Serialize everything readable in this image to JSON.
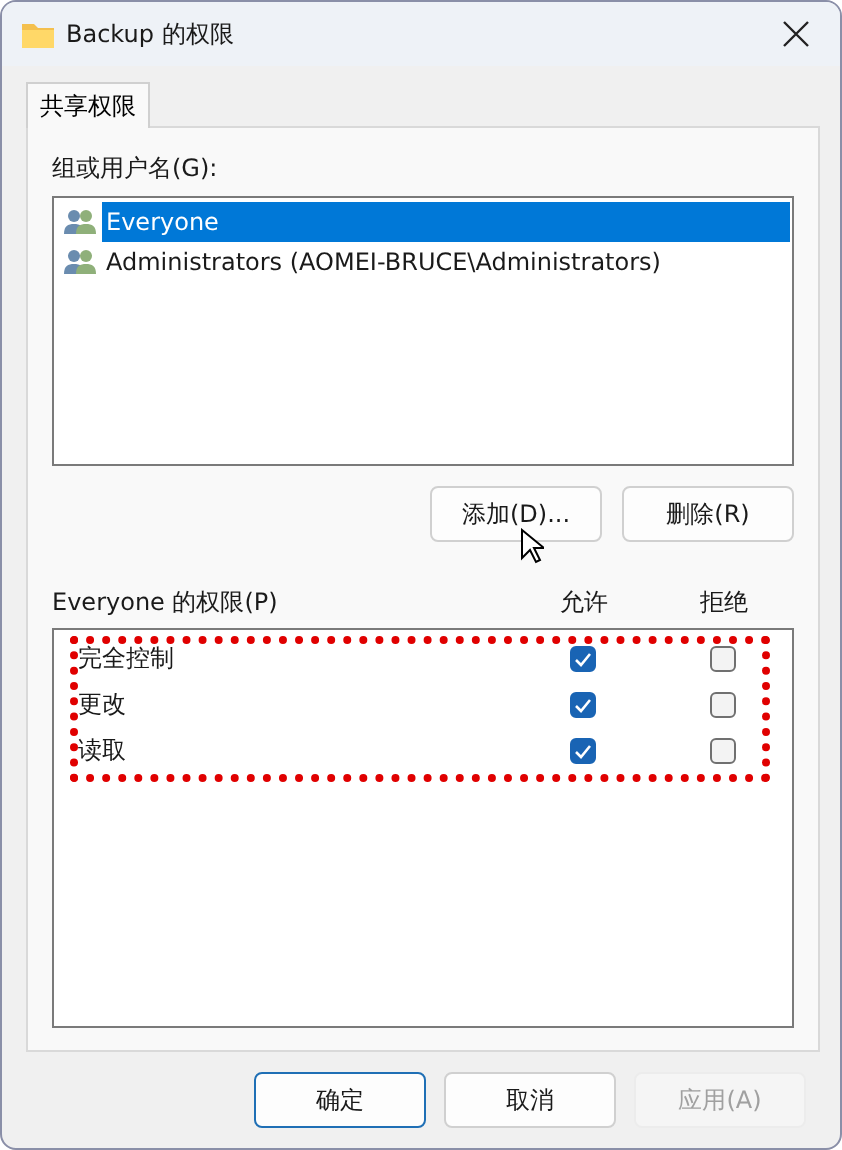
{
  "window": {
    "title": "Backup 的权限"
  },
  "tabs": [
    {
      "label": "共享权限",
      "selected": true
    }
  ],
  "users": {
    "label": "组或用户名(G):",
    "items": [
      {
        "name": "Everyone",
        "selected": true
      },
      {
        "name": "Administrators (AOMEI-BRUCE\\Administrators)",
        "selected": false
      }
    ]
  },
  "user_buttons": [
    {
      "label": "添加(D)...",
      "disabled": false
    },
    {
      "label": "删除(R)",
      "disabled": false
    }
  ],
  "permissions": {
    "label": "Everyone 的权限(P)",
    "columns": [
      "允许",
      "拒绝"
    ],
    "rows": [
      {
        "name": "完全控制",
        "allow": true,
        "deny": false
      },
      {
        "name": "更改",
        "allow": true,
        "deny": false
      },
      {
        "name": "读取",
        "allow": true,
        "deny": false
      }
    ]
  },
  "buttons": [
    {
      "label": "确定",
      "default": true,
      "disabled": false
    },
    {
      "label": "取消",
      "default": false,
      "disabled": false
    },
    {
      "label": "应用(A)",
      "default": false,
      "disabled": true
    }
  ]
}
